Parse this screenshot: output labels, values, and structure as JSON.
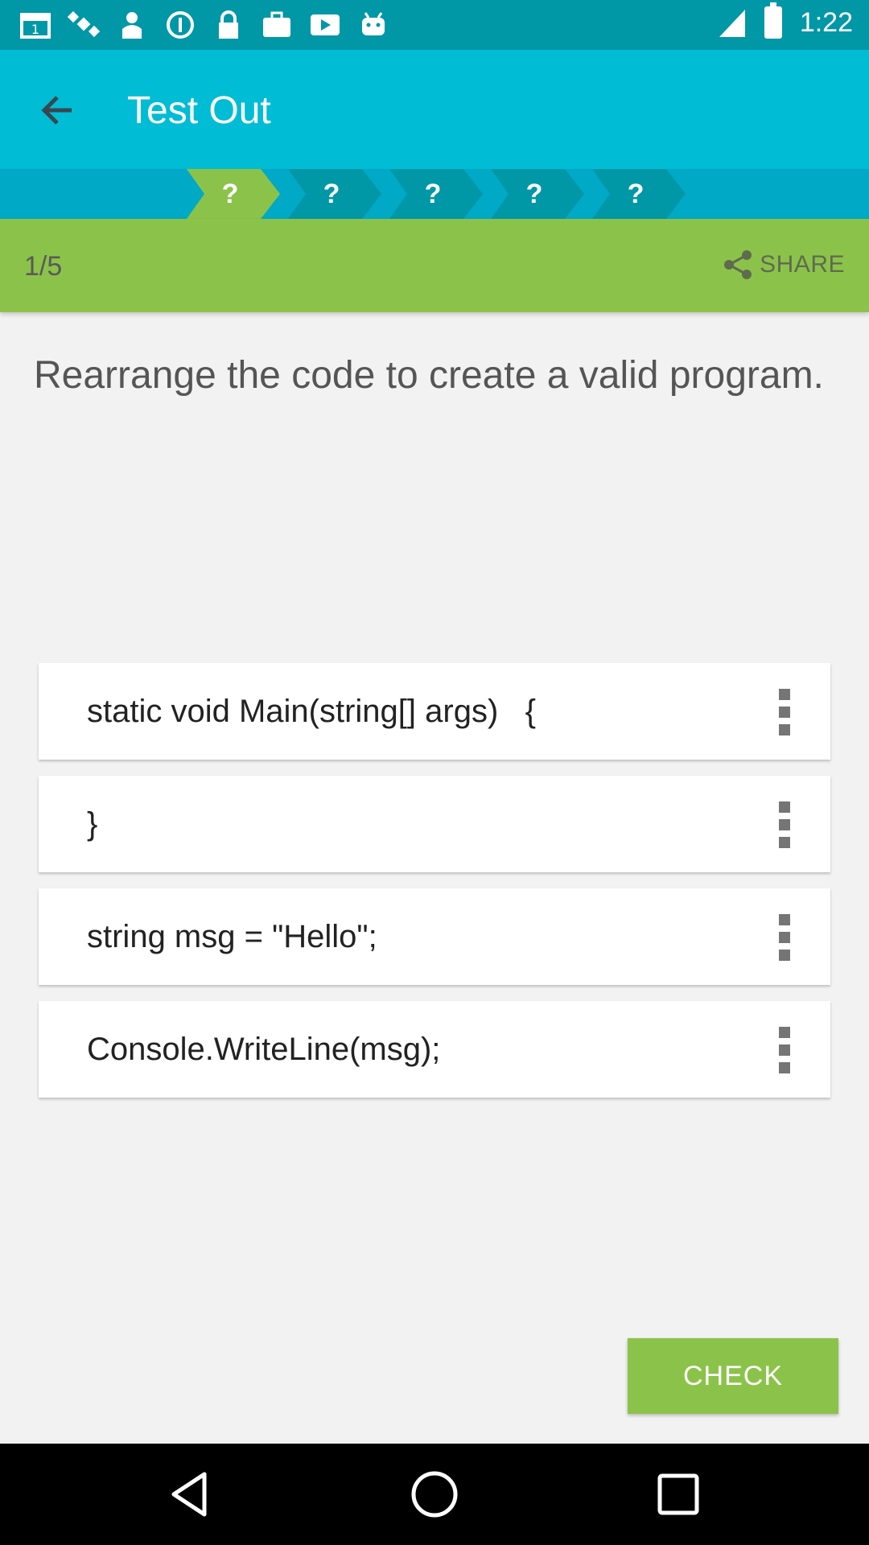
{
  "status_bar": {
    "time": "1:22",
    "icons": [
      "calendar-icon",
      "satellite-icon",
      "location-icon",
      "info-icon",
      "lock-icon",
      "briefcase-icon",
      "play-icon",
      "android-icon"
    ]
  },
  "app_bar": {
    "title": "Test Out",
    "back_icon": "arrow-back-icon"
  },
  "steps": {
    "items": [
      "?",
      "?",
      "?",
      "?",
      "?"
    ],
    "active_index": 0
  },
  "score_bar": {
    "progress": "1/5",
    "share_label": "SHARE"
  },
  "question": {
    "text": "Rearrange the code to create a valid program."
  },
  "code_blocks": [
    "static void Main(string[] args)   {",
    "}",
    "string msg = \"Hello\";",
    "Console.WriteLine(msg);"
  ],
  "check_button": {
    "label": "CHECK"
  },
  "colors": {
    "status_bar": "#0097a7",
    "app_bar": "#00bcd4",
    "step_active": "#8bc34a",
    "step_inactive": "#0097a7",
    "score_bar": "#8bc34a",
    "check_button": "#8bc34a"
  }
}
